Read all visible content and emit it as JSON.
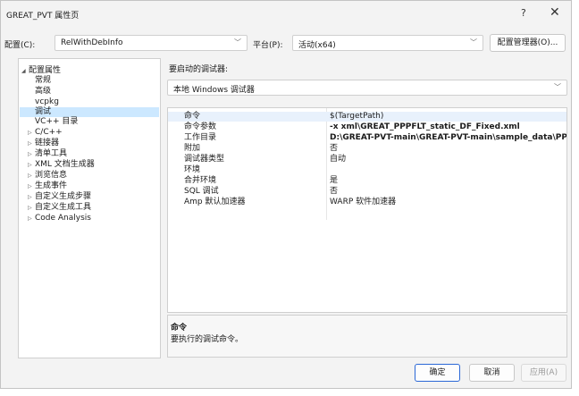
{
  "window": {
    "title": "GREAT_PVT 属性页",
    "help": "?",
    "close": "✕"
  },
  "config": {
    "config_label": "配置(C):",
    "config_value": "RelWithDebInfo",
    "platform_label": "平台(P):",
    "platform_value": "活动(x64)",
    "manager_button": "配置管理器(O)..."
  },
  "tree": [
    {
      "label": "配置属性",
      "expander": "◢"
    },
    {
      "label": "常规"
    },
    {
      "label": "高级"
    },
    {
      "label": "vcpkg"
    },
    {
      "label": "调试",
      "selected": true
    },
    {
      "label": "VC++ 目录"
    },
    {
      "label": "C/C++",
      "expander": "▷"
    },
    {
      "label": "链接器",
      "expander": "▷"
    },
    {
      "label": "清单工具",
      "expander": "▷"
    },
    {
      "label": "XML 文档生成器",
      "expander": "▷"
    },
    {
      "label": "浏览信息",
      "expander": "▷"
    },
    {
      "label": "生成事件",
      "expander": "▷"
    },
    {
      "label": "自定义生成步骤",
      "expander": "▷"
    },
    {
      "label": "自定义生成工具",
      "expander": "▷"
    },
    {
      "label": "Code Analysis",
      "expander": "▷"
    }
  ],
  "debugger": {
    "label": "要启动的调试器:",
    "value": "本地 Windows 调试器"
  },
  "properties": [
    {
      "name": "命令",
      "value": "$(TargetPath)"
    },
    {
      "name": "命令参数",
      "value": "-x xml\\GREAT_PPPFLT_static_DF_Fixed.xml"
    },
    {
      "name": "工作目录",
      "value": "D:\\GREAT-PVT-main\\GREAT-PVT-main\\sample_data\\PP"
    },
    {
      "name": "附加",
      "value": "否"
    },
    {
      "name": "调试器类型",
      "value": "自动"
    },
    {
      "name": "环境",
      "value": ""
    },
    {
      "name": "合并环境",
      "value": "是"
    },
    {
      "name": "SQL 调试",
      "value": "否"
    },
    {
      "name": "Amp 默认加速器",
      "value": "WARP 软件加速器"
    }
  ],
  "description": {
    "title": "命令",
    "text": "要执行的调试命令。"
  },
  "buttons": {
    "ok": "确定",
    "cancel": "取消",
    "apply": "应用(A)"
  },
  "icons": {
    "chevron": "chevron-down-icon"
  }
}
